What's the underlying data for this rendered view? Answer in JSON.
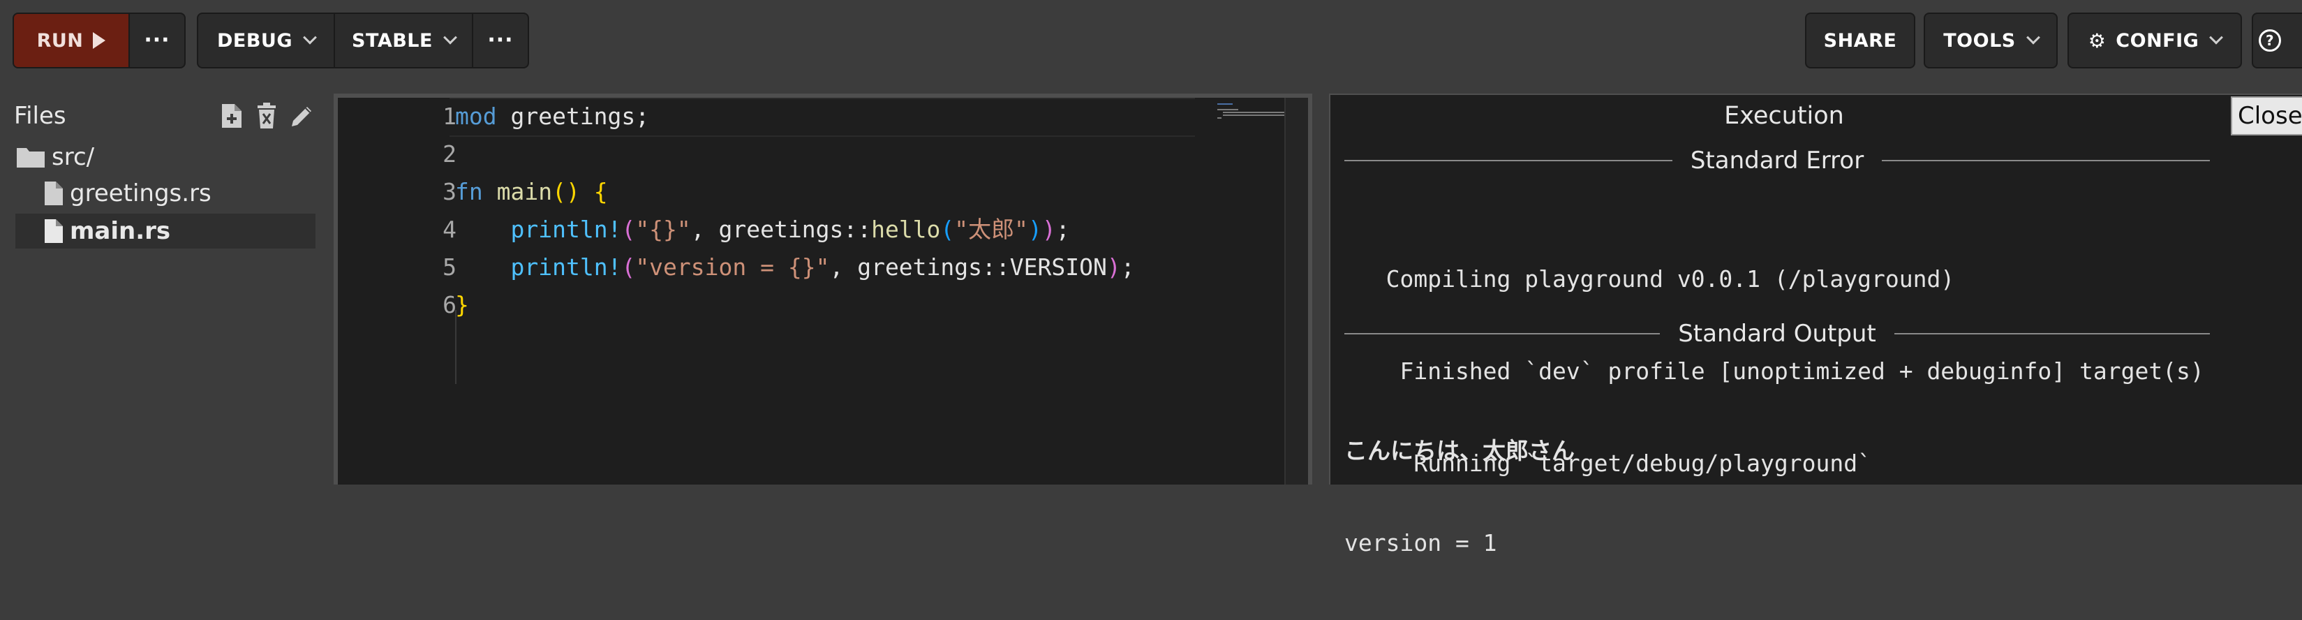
{
  "toolbar": {
    "run_label": "RUN",
    "debug_label": "DEBUG",
    "stable_label": "STABLE",
    "more_label": "···",
    "share_label": "SHARE",
    "tools_label": "TOOLS",
    "config_label": "CONFIG",
    "help_label": "?"
  },
  "sidebar": {
    "title": "Files",
    "items": [
      {
        "label": "src/",
        "kind": "folder"
      },
      {
        "label": "greetings.rs",
        "kind": "file"
      },
      {
        "label": "main.rs",
        "kind": "file",
        "selected": true
      }
    ]
  },
  "editor": {
    "line_numbers": [
      "1",
      "2",
      "3",
      "4",
      "5",
      "6"
    ]
  },
  "output": {
    "title": "Execution",
    "stderr_label": "Standard Error",
    "stderr_lines": [
      "   Compiling playground v0.0.1 (/playground)",
      "    Finished `dev` profile [unoptimized + debuginfo] target(s)",
      "     Running `target/debug/playground`"
    ],
    "stdout_label": "Standard Output",
    "stdout_lines": [
      "こんにちは、太郎さん",
      "version = 1"
    ],
    "close_label": "Close"
  },
  "colors": {
    "run_bg": "#6b1f12",
    "editor_bg": "#1e1e1e",
    "page_bg": "#3c3c3c",
    "keyword": "#569cd6",
    "string": "#ce9178"
  }
}
